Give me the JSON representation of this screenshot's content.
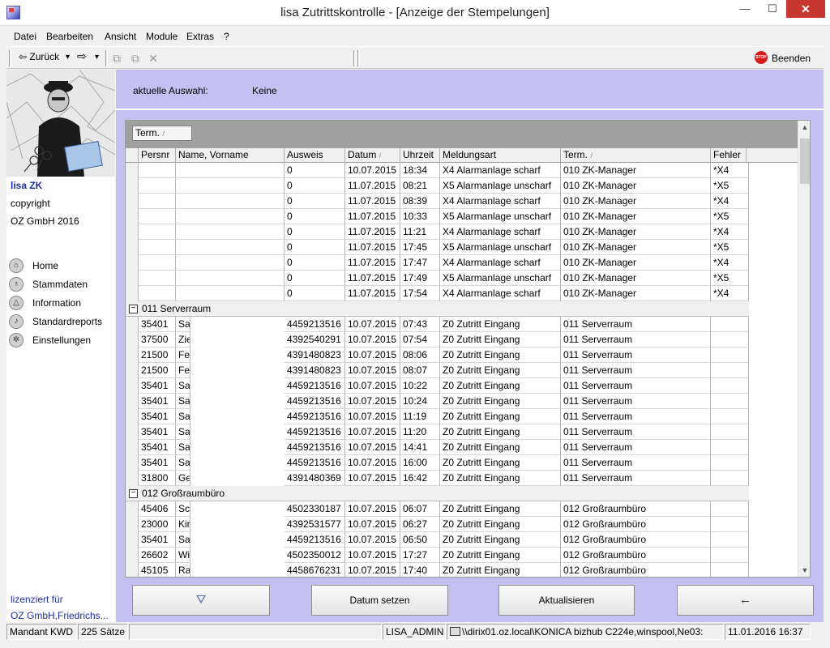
{
  "window": {
    "title": "lisa Zutrittskontrolle - [Anzeige der Stempelungen]",
    "min_glyph": "—",
    "max_glyph": "☐",
    "close_glyph": "✕"
  },
  "menu": [
    "Datei",
    "Bearbeiten",
    "Ansicht",
    "Module",
    "Extras",
    "?"
  ],
  "toolbar": {
    "back_label": "⇦ Zurück",
    "dropdown_glyph": "▾",
    "forward_label": "⇨",
    "exit_label": "Beenden",
    "stop_text": "STOP"
  },
  "sidebar": {
    "app_name": "lisa ZK",
    "copyright": "copyright",
    "company_year": "OZ GmbH 2016",
    "nav": [
      {
        "label": "Home",
        "icon": "home-icon"
      },
      {
        "label": "Stammdaten",
        "icon": "bulb-icon"
      },
      {
        "label": "Information",
        "icon": "triangle-icon"
      },
      {
        "label": "Standardreports",
        "icon": "note-icon"
      },
      {
        "label": "Einstellungen",
        "icon": "gear-icon"
      }
    ],
    "license_label": "lizenziert für",
    "license_company": "OZ GmbH,Friedrichs..."
  },
  "selection": {
    "label": "aktuelle Auswahl:",
    "value": "Keine"
  },
  "grid": {
    "group_chip": "Term.",
    "sort_glyph": "/",
    "columns": [
      "Persnr",
      "Name, Vorname",
      "Ausweis",
      "Datum",
      "Uhrzeit",
      "Meldungsart",
      "Term.",
      "Fehler"
    ],
    "rows_top": [
      {
        "persnr": "",
        "name": "",
        "ausweis": "0",
        "datum": "10.07.2015",
        "uhrzeit": "18:34",
        "meldung": "X4 Alarmanlage scharf",
        "term": "010  ZK-Manager",
        "fehler": "*X4"
      },
      {
        "persnr": "",
        "name": "",
        "ausweis": "0",
        "datum": "11.07.2015",
        "uhrzeit": "08:21",
        "meldung": "X5 Alarmanlage unscharf",
        "term": "010  ZK-Manager",
        "fehler": "*X5"
      },
      {
        "persnr": "",
        "name": "",
        "ausweis": "0",
        "datum": "11.07.2015",
        "uhrzeit": "08:39",
        "meldung": "X4 Alarmanlage scharf",
        "term": "010  ZK-Manager",
        "fehler": "*X4"
      },
      {
        "persnr": "",
        "name": "",
        "ausweis": "0",
        "datum": "11.07.2015",
        "uhrzeit": "10:33",
        "meldung": "X5 Alarmanlage unscharf",
        "term": "010  ZK-Manager",
        "fehler": "*X5"
      },
      {
        "persnr": "",
        "name": "",
        "ausweis": "0",
        "datum": "11.07.2015",
        "uhrzeit": "11:21",
        "meldung": "X4 Alarmanlage scharf",
        "term": "010  ZK-Manager",
        "fehler": "*X4"
      },
      {
        "persnr": "",
        "name": "",
        "ausweis": "0",
        "datum": "11.07.2015",
        "uhrzeit": "17:45",
        "meldung": "X5 Alarmanlage unscharf",
        "term": "010  ZK-Manager",
        "fehler": "*X5"
      },
      {
        "persnr": "",
        "name": "",
        "ausweis": "0",
        "datum": "11.07.2015",
        "uhrzeit": "17:47",
        "meldung": "X4 Alarmanlage scharf",
        "term": "010  ZK-Manager",
        "fehler": "*X4"
      },
      {
        "persnr": "",
        "name": "",
        "ausweis": "0",
        "datum": "11.07.2015",
        "uhrzeit": "17:49",
        "meldung": "X5 Alarmanlage unscharf",
        "term": "010  ZK-Manager",
        "fehler": "*X5"
      },
      {
        "persnr": "",
        "name": "",
        "ausweis": "0",
        "datum": "11.07.2015",
        "uhrzeit": "17:54",
        "meldung": "X4 Alarmanlage scharf",
        "term": "010  ZK-Manager",
        "fehler": "*X4"
      }
    ],
    "group_011": {
      "toggle": "−",
      "label": "011  Serverraum",
      "rows": [
        {
          "persnr": "35401",
          "name": "Sa",
          "ausweis": "4459213516",
          "datum": "10.07.2015",
          "uhrzeit": "07:43",
          "meldung": "Z0 Zutritt Eingang",
          "term": "011  Serverraum",
          "fehler": ""
        },
        {
          "persnr": "37500",
          "name": "Zie",
          "ausweis": "4392540291",
          "datum": "10.07.2015",
          "uhrzeit": "07:54",
          "meldung": "Z0 Zutritt Eingang",
          "term": "011  Serverraum",
          "fehler": ""
        },
        {
          "persnr": "21500",
          "name": "Fe",
          "ausweis": "4391480823",
          "datum": "10.07.2015",
          "uhrzeit": "08:06",
          "meldung": "Z0 Zutritt Eingang",
          "term": "011  Serverraum",
          "fehler": ""
        },
        {
          "persnr": "21500",
          "name": "Fe",
          "ausweis": "4391480823",
          "datum": "10.07.2015",
          "uhrzeit": "08:07",
          "meldung": "Z0 Zutritt Eingang",
          "term": "011  Serverraum",
          "fehler": ""
        },
        {
          "persnr": "35401",
          "name": "Sa",
          "ausweis": "4459213516",
          "datum": "10.07.2015",
          "uhrzeit": "10:22",
          "meldung": "Z0 Zutritt Eingang",
          "term": "011  Serverraum",
          "fehler": ""
        },
        {
          "persnr": "35401",
          "name": "Sa",
          "ausweis": "4459213516",
          "datum": "10.07.2015",
          "uhrzeit": "10:24",
          "meldung": "Z0 Zutritt Eingang",
          "term": "011  Serverraum",
          "fehler": ""
        },
        {
          "persnr": "35401",
          "name": "Sa",
          "ausweis": "4459213516",
          "datum": "10.07.2015",
          "uhrzeit": "11:19",
          "meldung": "Z0 Zutritt Eingang",
          "term": "011  Serverraum",
          "fehler": ""
        },
        {
          "persnr": "35401",
          "name": "Sa",
          "ausweis": "4459213516",
          "datum": "10.07.2015",
          "uhrzeit": "11:20",
          "meldung": "Z0 Zutritt Eingang",
          "term": "011  Serverraum",
          "fehler": ""
        },
        {
          "persnr": "35401",
          "name": "Sa",
          "ausweis": "4459213516",
          "datum": "10.07.2015",
          "uhrzeit": "14:41",
          "meldung": "Z0 Zutritt Eingang",
          "term": "011  Serverraum",
          "fehler": ""
        },
        {
          "persnr": "35401",
          "name": "Sa",
          "ausweis": "4459213516",
          "datum": "10.07.2015",
          "uhrzeit": "16:00",
          "meldung": "Z0 Zutritt Eingang",
          "term": "011  Serverraum",
          "fehler": ""
        },
        {
          "persnr": "31800",
          "name": "Ge",
          "ausweis": "4391480369",
          "datum": "10.07.2015",
          "uhrzeit": "16:42",
          "meldung": "Z0 Zutritt Eingang",
          "term": "011  Serverraum",
          "fehler": ""
        }
      ]
    },
    "group_012": {
      "toggle": "−",
      "label": "012  Großraumbüro",
      "rows": [
        {
          "persnr": "45406",
          "name": "Sc",
          "ausweis": "4502330187",
          "datum": "10.07.2015",
          "uhrzeit": "06:07",
          "meldung": "Z0 Zutritt Eingang",
          "term": "012  Großraumbüro",
          "fehler": ""
        },
        {
          "persnr": "23000",
          "name": "Kir",
          "ausweis": "4392531577",
          "datum": "10.07.2015",
          "uhrzeit": "06:27",
          "meldung": "Z0 Zutritt Eingang",
          "term": "012  Großraumbüro",
          "fehler": ""
        },
        {
          "persnr": "35401",
          "name": "Sa",
          "ausweis": "4459213516",
          "datum": "10.07.2015",
          "uhrzeit": "06:50",
          "meldung": "Z0 Zutritt Eingang",
          "term": "012  Großraumbüro",
          "fehler": ""
        },
        {
          "persnr": "26602",
          "name": "Wi",
          "ausweis": "4502350012",
          "datum": "10.07.2015",
          "uhrzeit": "17:27",
          "meldung": "Z0 Zutritt Eingang",
          "term": "012  Großraumbüro",
          "fehler": ""
        },
        {
          "persnr": "45105",
          "name": "Ra",
          "ausweis": "4458676231",
          "datum": "10.07.2015",
          "uhrzeit": "17:40",
          "meldung": "Z0 Zutritt Eingang",
          "term": "012  Großraumbüro",
          "fehler": ""
        }
      ]
    },
    "scroll_up": "▲",
    "scroll_down": "▼"
  },
  "buttons": {
    "filter_glyph": "⛛",
    "set_date": "Datum setzen",
    "refresh": "Aktualisieren",
    "back_glyph": "←"
  },
  "statusbar": {
    "mandant": "Mandant KWD",
    "count": "225 Sätze",
    "user": "LISA_ADMIN",
    "printer": "\\\\dirix01.oz.local\\KONICA bizhub C224e,winspool,Ne03:",
    "datetime": "11.01.2016 16:37"
  }
}
